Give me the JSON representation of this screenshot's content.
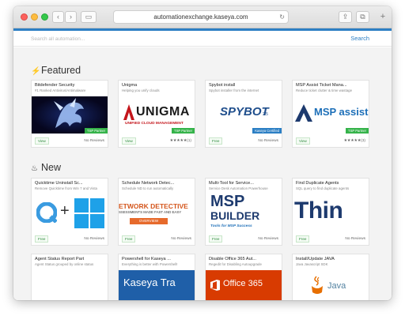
{
  "browser": {
    "url": "automationexchange.kaseya.com",
    "back_glyph": "‹",
    "forward_glyph": "›",
    "sidebar_glyph": "▭",
    "reload_glyph": "↻",
    "share_glyph": "⇪",
    "tabs_glyph": "⧉",
    "new_tab_glyph": "+"
  },
  "search": {
    "placeholder": "Search all automation...",
    "button_label": "Search"
  },
  "sections": {
    "featured": {
      "title": "Featured",
      "icon": "lightning-icon",
      "icon_glyph": "⚡"
    },
    "new": {
      "title": "New",
      "icon": "flame-icon",
      "icon_glyph": "♨"
    }
  },
  "featured_cards": [
    {
      "title": "Bitdefender Security",
      "subtitle": "#1 Ranked Antivirus/Antimalware",
      "badge": "TSP Partner",
      "pill": "View",
      "rating": "No Reviews",
      "image_text": ""
    },
    {
      "title": "Unigma",
      "subtitle": "Helping you unify clouds",
      "badge": "TSP Partner",
      "pill": "View",
      "rating": "★★★★★(1)",
      "image_text": "UNIGMA",
      "image_sub": "UNIFIED CLOUD MANAGEMENT"
    },
    {
      "title": "Spybot install",
      "subtitle": "Spybot installer from the internet",
      "badge": "Kaseya Certified",
      "pill": "Free",
      "rating": "No Reviews",
      "image_text": "SPYBOT",
      "image_sub": "2.5"
    },
    {
      "title": "MSP Assist Ticket Mana...",
      "subtitle": "Reduce ticket clutter & time wastage",
      "badge": "TSP Partner",
      "pill": "View",
      "rating": "★★★★★(3)",
      "image_text": "MSP assist"
    }
  ],
  "new_cards": [
    {
      "title": "Quicktime Uninstall Sc...",
      "subtitle": "Remove Quicktime from Win 7 and Vista",
      "pill": "Free",
      "rating": "No Reviews",
      "image_text": "+"
    },
    {
      "title": "Schedule Network Detec...",
      "subtitle": "Schedule ND to run automatically",
      "pill": "Free",
      "rating": "No Reviews",
      "image_text": "ETWORK DETECTIVE",
      "image_sub": "SSESSMENTS MADE FAST AND EASY",
      "image_tab": "OVERVIEW"
    },
    {
      "title": "Multi-Tool for Service...",
      "subtitle": "Service Desk Automation Powerhouse",
      "pill": "Free",
      "rating": "No Reviews",
      "image_text": "MSP",
      "image_text2": "BUILDER",
      "image_sub": "Tools for MSP Success"
    },
    {
      "title": "Find Duplicate Agents",
      "subtitle": "SQL query to find duplicate agents",
      "pill": "Free",
      "rating": "No Reviews",
      "image_text": "Thin"
    }
  ],
  "row3_cards": [
    {
      "title": "Agent Status Report Part",
      "subtitle": "Agent Status grouped by online status",
      "image_text": ""
    },
    {
      "title": "Powershell for Kaseya ...",
      "subtitle": "Everything is better with Powershell!",
      "image_text": "Kaseya Tra"
    },
    {
      "title": "Disable Office 365 Aut...",
      "subtitle": "Regedit for Disabling Autoupgrade",
      "image_text": "Office 365"
    },
    {
      "title": "Install/Update JAVA",
      "subtitle": "Java Javascript SDK",
      "image_text": "Java"
    }
  ],
  "colors": {
    "accent": "#2c7fc4",
    "badge_green": "#35b34a",
    "unigma_red": "#c4161c",
    "kaseya_blue": "#1f5fa8",
    "office_red": "#d83b01",
    "msp_navy": "#1d3a6e"
  }
}
